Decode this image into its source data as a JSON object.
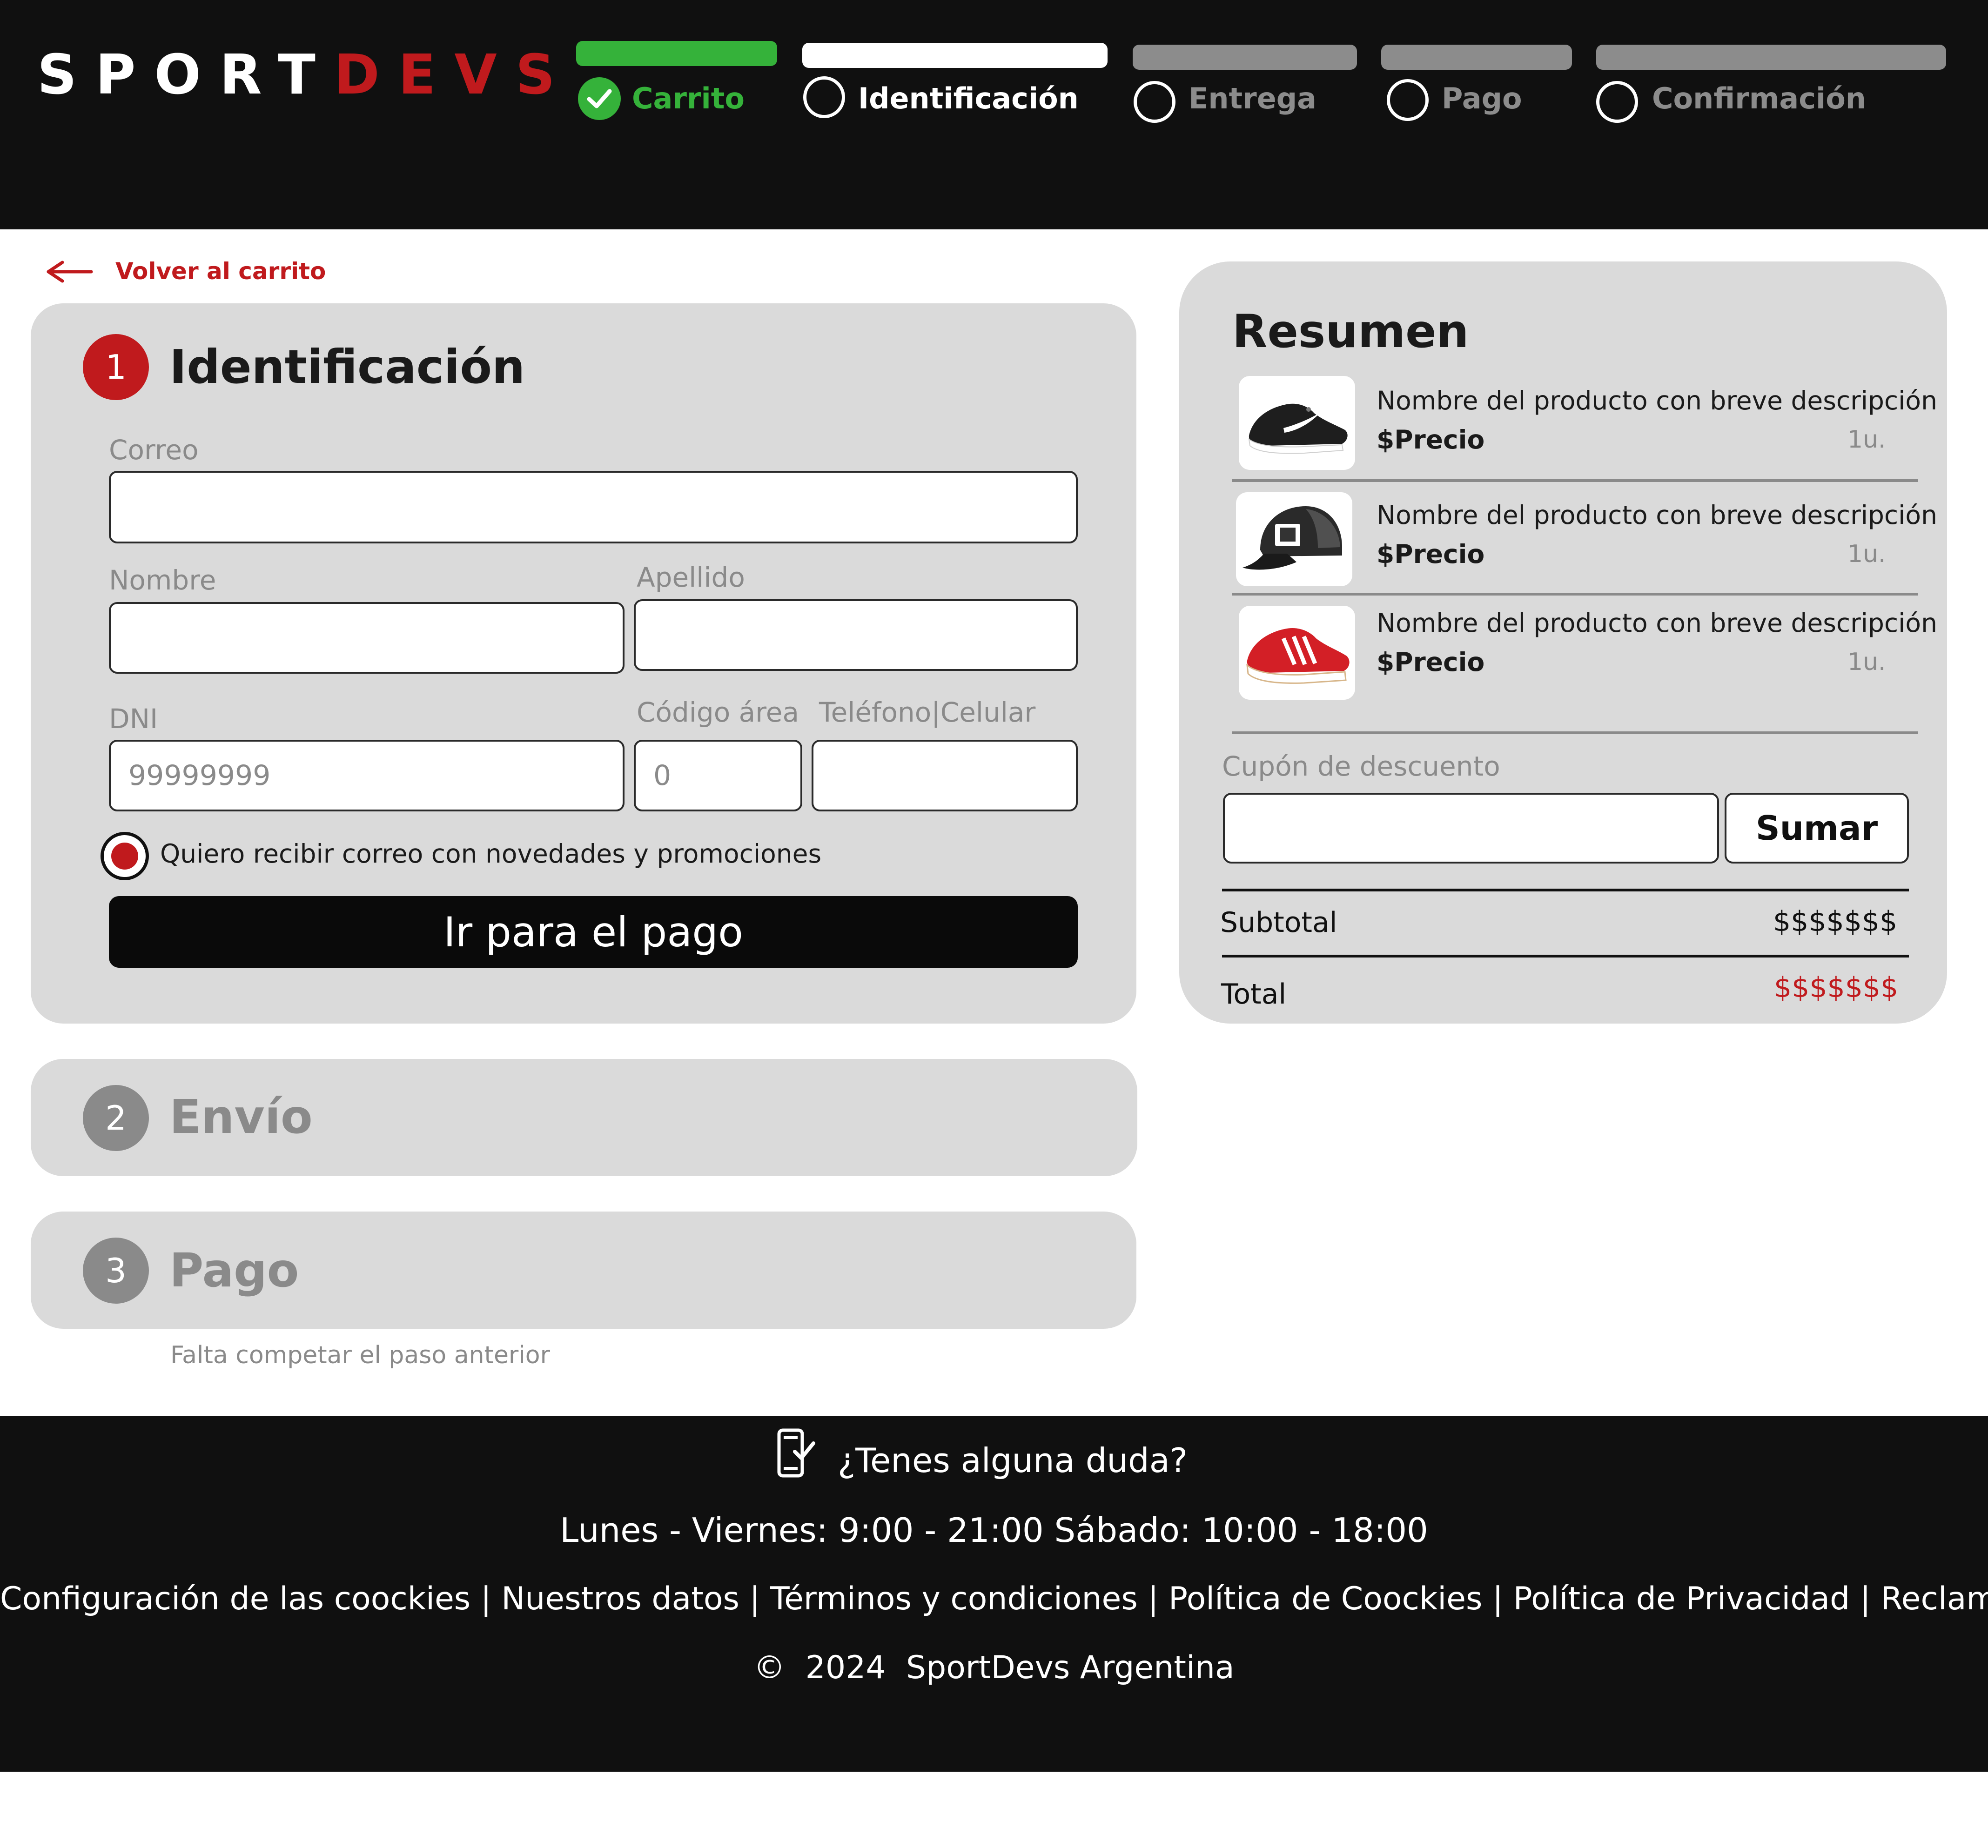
{
  "header": {
    "logo_part1": "SPORT",
    "logo_part2": "DEVS",
    "steps": [
      {
        "label": "Carrito",
        "state": "done",
        "color": "#35b23a"
      },
      {
        "label": "Identificación",
        "state": "active",
        "color": "#ffffff"
      },
      {
        "label": "Entrega",
        "state": "pending",
        "color": "#8c8c8c"
      },
      {
        "label": "Pago",
        "state": "pending",
        "color": "#8c8c8c"
      },
      {
        "label": "Confirmación",
        "state": "pending",
        "color": "#8c8c8c"
      }
    ]
  },
  "back_link": {
    "label": "Volver al carrito",
    "icon": "arrow-left-icon"
  },
  "identificacion": {
    "number": "1",
    "title": "Identificación",
    "correo_label": "Correo",
    "correo_value": "",
    "nombre_label": "Nombre",
    "nombre_value": "",
    "apellido_label": "Apellido",
    "apellido_value": "",
    "dni_label": "DNI",
    "dni_placeholder": "99999999",
    "area_label": "Código área",
    "area_placeholder": "0",
    "telefono_label": "Teléfono|Celular",
    "telefono_value": "",
    "newsletter_label": "Quiero recibir correo con novedades y promociones",
    "newsletter_checked": true,
    "submit_label": "Ir para el pago"
  },
  "envio": {
    "number": "2",
    "title": "Envío"
  },
  "pago": {
    "number": "3",
    "title": "Pago",
    "note": "Falta competar el paso anterior"
  },
  "resumen": {
    "title": "Resumen",
    "items": [
      {
        "name": "Nombre del producto con breve descripción",
        "price": "$Precio",
        "qty": "1u.",
        "image": "sneaker-black-icon"
      },
      {
        "name": "Nombre del producto con breve descripción",
        "price": "$Precio",
        "qty": "1u.",
        "image": "cap-black-icon"
      },
      {
        "name": "Nombre del producto con breve descripción",
        "price": "$Precio",
        "qty": "1u.",
        "image": "sneaker-red-icon"
      }
    ],
    "coupon_label": "Cupón de descuento",
    "coupon_value": "",
    "coupon_button": "Sumar",
    "subtotal_label": "Subtotal",
    "subtotal_value": "$$$$$$$",
    "total_label": "Total",
    "total_value": "$$$$$$$",
    "total_color": "#c01a1d"
  },
  "footer": {
    "question": "¿Tenes alguna duda?",
    "hours": "Lunes - Viernes: 9:00 - 21:00 Sábado: 10:00 - 18:00",
    "links": [
      "Configuración de las coockies",
      "Nuestros datos",
      "Términos y condiciones",
      "Política de Coockies",
      "Política de Privacidad",
      "Reclamos"
    ],
    "separator": "|",
    "copyright_symbol": "©",
    "year": "2024",
    "company": "SportDevs Argentina"
  },
  "colors": {
    "brand_red": "#c01a1d",
    "done_green": "#35b23a",
    "dark": "#101010",
    "card": "#dadada",
    "muted": "#8a8a8a"
  }
}
